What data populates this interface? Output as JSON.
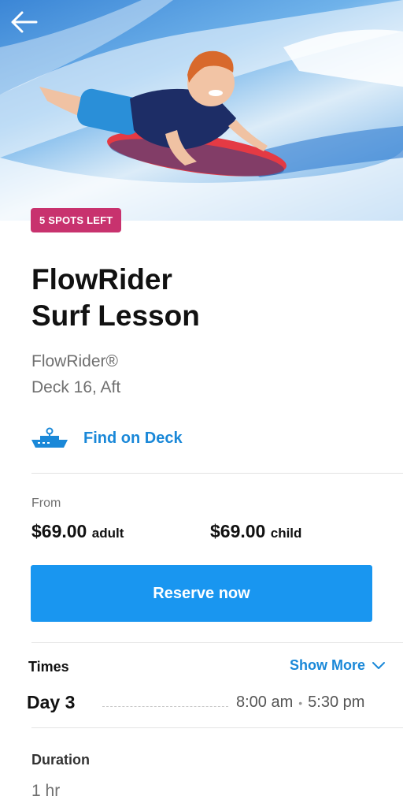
{
  "badge": "5 SPOTS LEFT",
  "activity": {
    "title_line1": "FlowRider",
    "title_line2": "Surf Lesson",
    "venue": "FlowRider®",
    "deck": "Deck 16, Aft"
  },
  "find_on_deck": {
    "label": "Find on Deck",
    "icon": "ship-icon"
  },
  "pricing": {
    "from_label": "From",
    "adult_price": "$69.00",
    "adult_label": "adult",
    "child_price": "$69.00",
    "child_label": "child"
  },
  "reserve_button": "Reserve now",
  "times": {
    "label": "Times",
    "show_more": "Show More",
    "day": "Day 3",
    "start": "8:00 am",
    "separator": "•",
    "end": "5:30 pm"
  },
  "duration": {
    "label": "Duration",
    "value": "1 hr"
  },
  "colors": {
    "accent": "#1a88d8",
    "button": "#1996f0",
    "badge": "#c8326e"
  }
}
